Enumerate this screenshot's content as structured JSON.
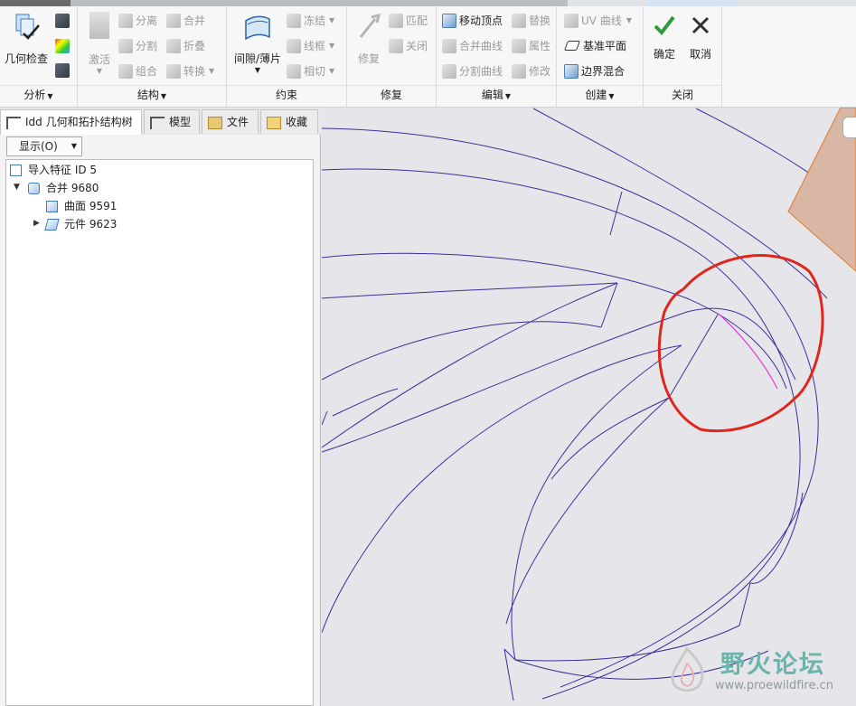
{
  "ribbon": {
    "analysis": {
      "label": "分析",
      "check_label": "几何检查"
    },
    "structure": {
      "label": "结构",
      "activate": "激活",
      "separate": "分离",
      "merge": "合并",
      "split": "分割",
      "fold": "折叠",
      "group": "组合",
      "convert": "转换"
    },
    "constraints": {
      "label": "约束",
      "gap_thin": "间隙/薄片",
      "freeze": "冻结",
      "wireframe": "线框",
      "tangent": "相切"
    },
    "repair": {
      "label": "修复",
      "repair": "修复",
      "match": "匹配",
      "close": "关闭"
    },
    "edit": {
      "label": "编辑",
      "move_vertex": "移动顶点",
      "replace": "替换",
      "merge_curve": "合并曲线",
      "properties": "属性",
      "split_curve": "分割曲线",
      "modify": "修改"
    },
    "create": {
      "label": "创建",
      "uv_curve": "UV 曲线",
      "datum_plane": "基准平面",
      "boundary_blend": "边界混合"
    },
    "close": {
      "label": "关闭",
      "ok": "确定",
      "cancel": "取消"
    }
  },
  "tabs": [
    {
      "label": "Idd 几何和拓扑结构树"
    },
    {
      "label": "模型"
    },
    {
      "label": "文件"
    },
    {
      "label": "收藏"
    }
  ],
  "panel": {
    "show_label": "显示(O)"
  },
  "tree": [
    {
      "label": "导入特征 ID 5"
    },
    {
      "label": "合并 9680"
    },
    {
      "label": "曲面 9591"
    },
    {
      "label": "元件 9623"
    }
  ],
  "watermark": {
    "title": "野火论坛",
    "url": "www.proewildfire.cn"
  },
  "colors": {
    "wire": "#3a2f9a",
    "highlight": "#e23ad6",
    "annotation": "#e0261c",
    "surface": "#d8b7a5"
  }
}
